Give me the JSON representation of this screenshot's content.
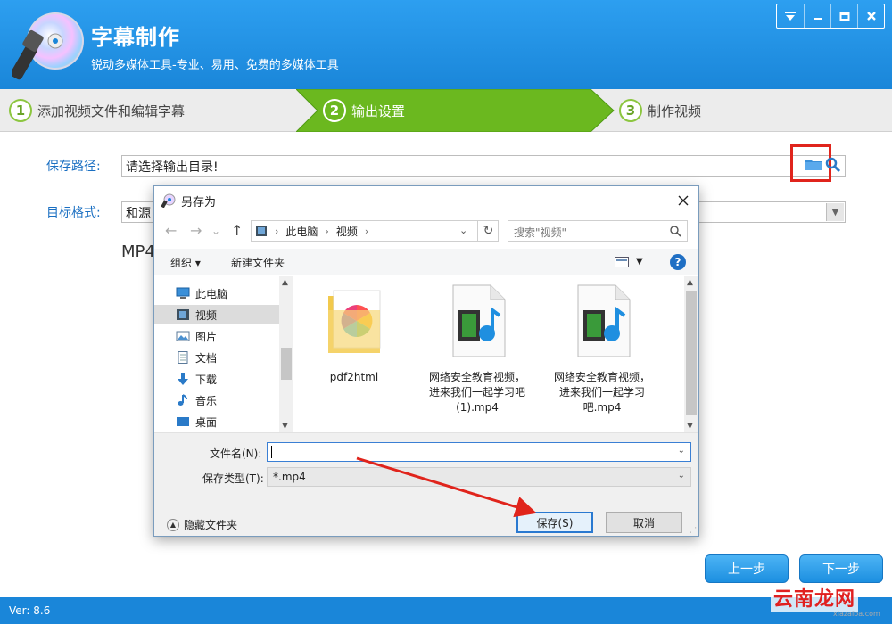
{
  "app": {
    "title": "字幕制作",
    "subtitle": "锐动多媒体工具-专业、易用、免费的多媒体工具",
    "version": "Ver: 8.6",
    "window_controls": [
      "menu-icon",
      "minimize-icon",
      "maximize-icon",
      "close-icon"
    ]
  },
  "steps": [
    {
      "num": "1",
      "label": "添加视频文件和编辑字幕",
      "active": false
    },
    {
      "num": "2",
      "label": "输出设置",
      "active": true
    },
    {
      "num": "3",
      "label": "制作视频",
      "active": false
    }
  ],
  "form": {
    "save_path_label": "保存路径:",
    "save_path_value": "请选择输出目录!",
    "target_format_label": "目标格式:",
    "target_format_value": "和源",
    "format_big_text": "MP4"
  },
  "nav": {
    "prev_label": "上一步",
    "next_label": "下一步"
  },
  "watermark": {
    "main": "云南龙网",
    "sub": "xiazaiba.com"
  },
  "dialog": {
    "title": "另存为",
    "breadcrumb": [
      "此电脑",
      "视频"
    ],
    "search_placeholder": "搜索\"视频\"",
    "toolbar": {
      "organize": "组织 ▾",
      "new_folder": "新建文件夹"
    },
    "tree": [
      {
        "label": "此电脑",
        "icon": "computer-icon",
        "selected": false
      },
      {
        "label": "视频",
        "icon": "video-folder-icon",
        "selected": true
      },
      {
        "label": "图片",
        "icon": "pictures-icon",
        "selected": false
      },
      {
        "label": "文档",
        "icon": "documents-icon",
        "selected": false
      },
      {
        "label": "下载",
        "icon": "download-icon",
        "selected": false
      },
      {
        "label": "音乐",
        "icon": "music-icon",
        "selected": false
      },
      {
        "label": "桌面",
        "icon": "desktop-icon",
        "selected": false
      }
    ],
    "files": [
      {
        "name": "pdf2html",
        "icon": "folder-icon"
      },
      {
        "name": "网络安全教育视频，进来我们一起学习吧(1).mp4",
        "icon": "video-file-icon"
      },
      {
        "name": "网络安全教育视频，进来我们一起学习吧.mp4",
        "icon": "video-file-icon"
      }
    ],
    "filename_label": "文件名(N):",
    "filename_value": "",
    "filetype_label": "保存类型(T):",
    "filetype_value": "*.mp4",
    "hide_folders": "隐藏文件夹",
    "save_button": "保存(S)",
    "cancel_button": "取消"
  },
  "colors": {
    "header_blue": "#1a86d9",
    "active_step_green": "#6bb81f",
    "highlight_red": "#e0241c",
    "label_blue": "#1a6fc2"
  }
}
